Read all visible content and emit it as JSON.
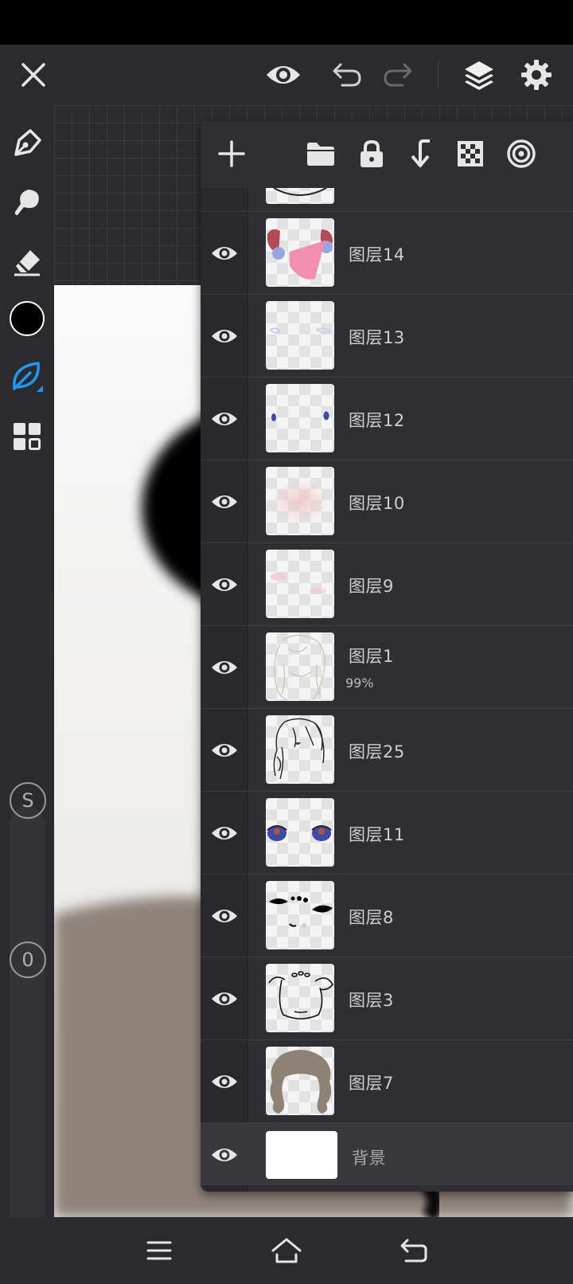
{
  "layers": [
    {
      "name": "图层14",
      "opacity": ""
    },
    {
      "name": "图层13",
      "opacity": ""
    },
    {
      "name": "图层12",
      "opacity": ""
    },
    {
      "name": "图层10",
      "opacity": ""
    },
    {
      "name": "图层9",
      "opacity": ""
    },
    {
      "name": "图层1",
      "opacity": "99%"
    },
    {
      "name": "图层25",
      "opacity": ""
    },
    {
      "name": "图层11",
      "opacity": ""
    },
    {
      "name": "图层8",
      "opacity": ""
    },
    {
      "name": "图层3",
      "opacity": ""
    },
    {
      "name": "图层7",
      "opacity": ""
    },
    {
      "name": "背景",
      "opacity": ""
    }
  ],
  "left_toolbar": {
    "slider_size_label": "S",
    "slider_opacity_label": "0",
    "current_color": "#000000"
  },
  "colors": {
    "accent": "#2196f3",
    "toolbar_bg": "#2b2b2f",
    "panel_bg": "#2e2e33"
  },
  "icons": {
    "top_toolbar": [
      "close-icon",
      "eye-icon",
      "undo-icon",
      "redo-icon",
      "layers-icon",
      "gear-icon"
    ],
    "left_toolbar": [
      "pen-icon",
      "smudge-icon",
      "eraser-icon",
      "color-swatch",
      "leaf-brush-icon",
      "grid-icon"
    ],
    "layer_panel": [
      "plus-icon",
      "folder-icon",
      "lock-icon",
      "merge-down-icon",
      "transparency-icon",
      "target-icon"
    ],
    "nav_bar": [
      "menu-icon",
      "home-icon",
      "back-icon"
    ]
  }
}
